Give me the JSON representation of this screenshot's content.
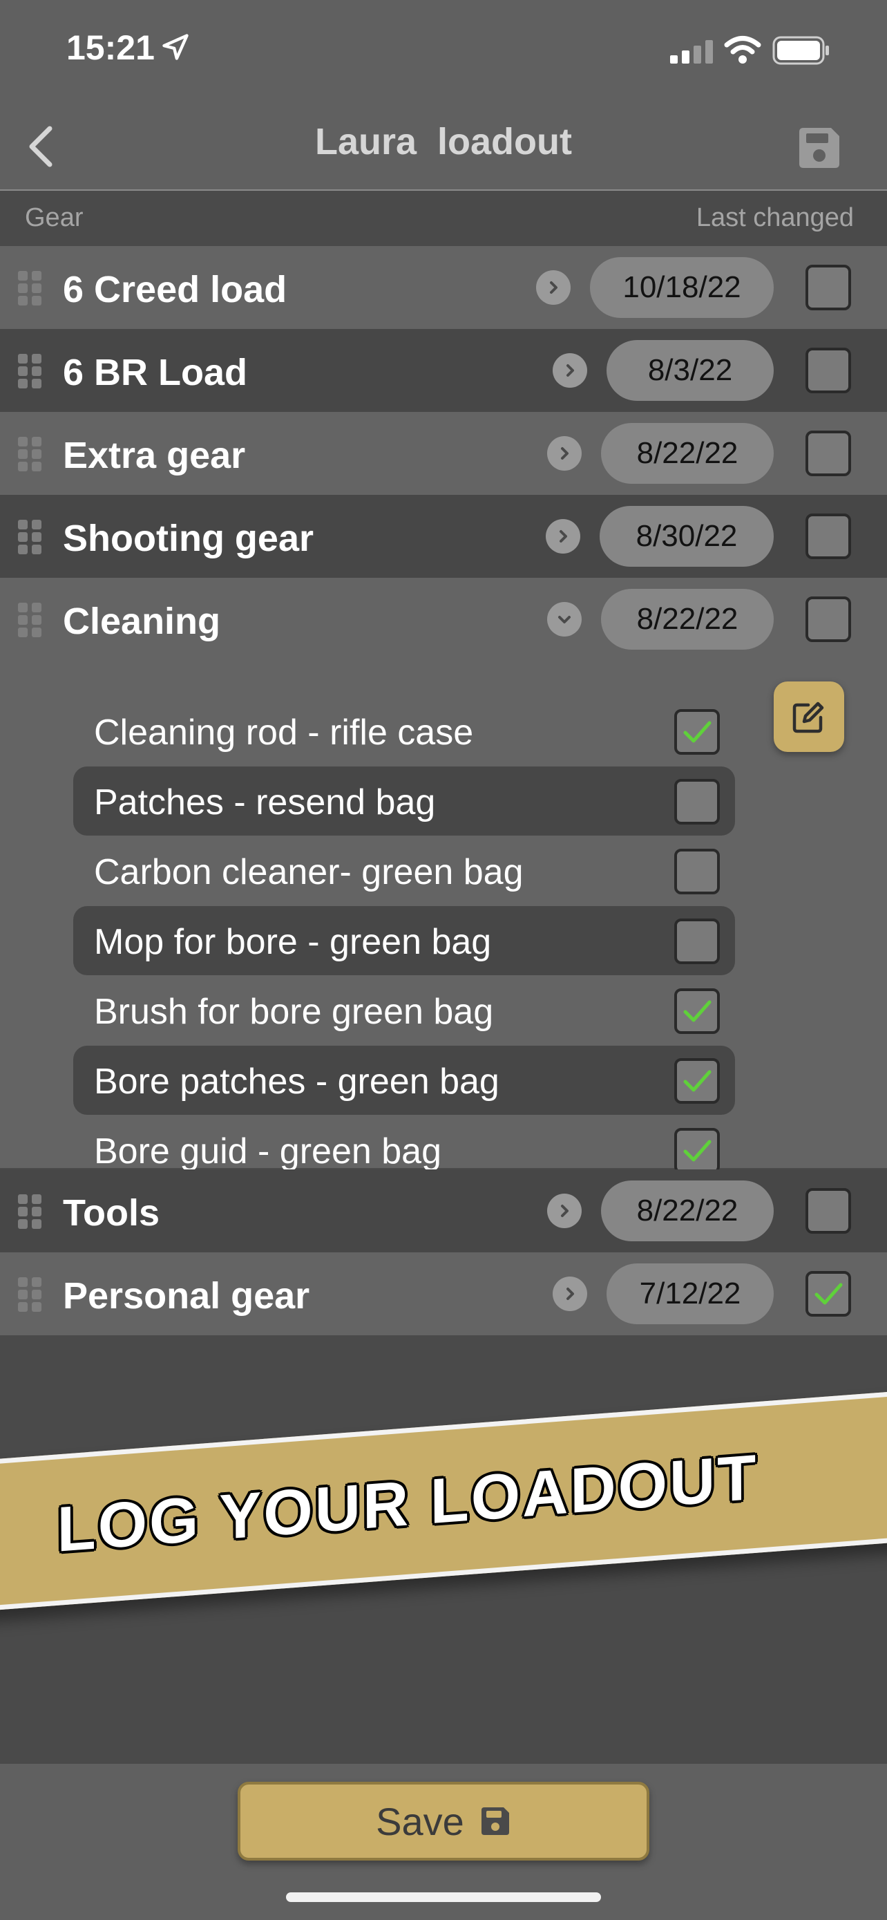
{
  "status_bar": {
    "time": "15:21"
  },
  "nav": {
    "title": "Laura  loadout"
  },
  "columns": {
    "gear": "Gear",
    "last_changed": "Last changed"
  },
  "groups_top": [
    {
      "name": "6 Creed load",
      "date": "10/18/22",
      "checked": false
    },
    {
      "name": "6 BR Load",
      "date": "8/3/22",
      "checked": false
    },
    {
      "name": "Extra gear",
      "date": "8/22/22",
      "checked": false
    },
    {
      "name": "Shooting gear",
      "date": "8/30/22",
      "checked": false
    },
    {
      "name": "Cleaning",
      "date": "8/22/22",
      "checked": false,
      "expanded": true
    }
  ],
  "cleaning_items": [
    {
      "label": "Cleaning rod - rifle case",
      "checked": true
    },
    {
      "label": "Patches - resend bag",
      "checked": false
    },
    {
      "label": "Carbon cleaner- green bag",
      "checked": false
    },
    {
      "label": "Mop for bore - green bag",
      "checked": false
    },
    {
      "label": "Brush for bore green bag",
      "checked": true
    },
    {
      "label": "Bore patches - green bag",
      "checked": true
    },
    {
      "label": "Bore guid - green bag",
      "checked": true
    }
  ],
  "groups_bottom": [
    {
      "name": "Tools",
      "date": "8/22/22",
      "checked": false
    },
    {
      "name": "Personal gear",
      "date": "7/12/22",
      "checked": true
    }
  ],
  "banner": {
    "text": "LOG YOUR LOADOUT"
  },
  "footer": {
    "save_label": "Save"
  },
  "colors": {
    "accent": "#c9ae68",
    "check": "#5fd13a",
    "row_light": "#646464",
    "row_dark": "#474747"
  },
  "icons": [
    "location-arrow-icon",
    "signal-icon",
    "wifi-icon",
    "battery-icon",
    "back-chevron-icon",
    "floppy-save-icon",
    "drag-handle-icon",
    "chevron-right-icon",
    "chevron-down-icon",
    "checkmark-icon",
    "edit-pencil-icon"
  ]
}
